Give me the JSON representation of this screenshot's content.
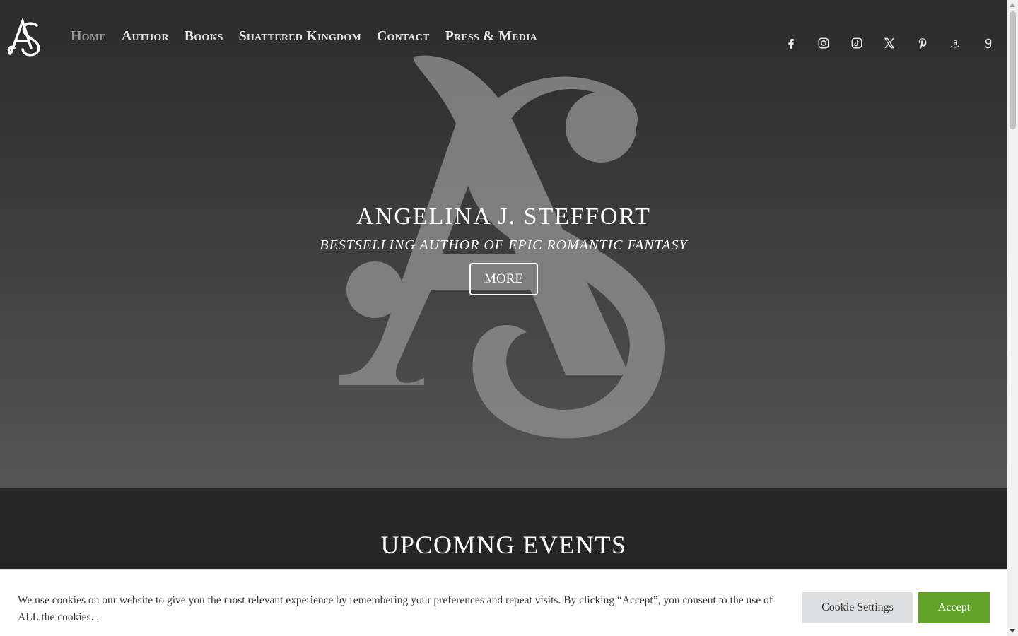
{
  "nav": {
    "items": [
      {
        "label": "Home",
        "active": true
      },
      {
        "label": "Author",
        "active": false
      },
      {
        "label": "Books",
        "active": false
      },
      {
        "label": "Shattered Kingdom",
        "active": false
      },
      {
        "label": "Contact",
        "active": false
      },
      {
        "label": "Press & Media",
        "active": false
      }
    ]
  },
  "social": {
    "icons": [
      "facebook-icon",
      "instagram-icon",
      "tiktok-icon",
      "x-icon",
      "pinterest-icon",
      "amazon-icon",
      "goodreads-icon"
    ]
  },
  "hero": {
    "title": "ANGELINA J. STEFFORT",
    "subtitle": "BESTSELLING AUTHOR OF EPIC ROMANTIC FANTASY",
    "button_label": "MORE"
  },
  "events": {
    "title": "UPCOMNG EVENTS"
  },
  "cookie": {
    "text": "We use cookies on our website to give you the most relevant experience by remembering your preferences and repeat visits. By clicking “Accept”, you consent to the use of ALL the cookies. .",
    "settings_label": "Cookie Settings",
    "accept_label": "Accept"
  },
  "colors": {
    "accept_green": "#61a229",
    "nav_active": "#9a9a9a",
    "header_bg": "#2b2b2b"
  }
}
